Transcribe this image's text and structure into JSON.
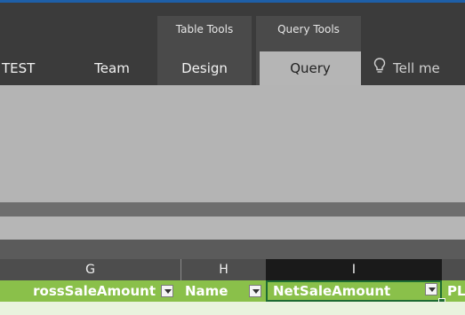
{
  "ribbon": {
    "contextual_groups": [
      {
        "label": "Table Tools"
      },
      {
        "label": "Query Tools"
      }
    ],
    "tabs": [
      "TEST",
      "Team",
      "Design",
      "Query"
    ],
    "active_tab": "Query",
    "tell_me": "Tell me"
  },
  "sheet": {
    "column_headers": [
      "G",
      "H",
      "I"
    ],
    "selected_column": "I",
    "field_headers": [
      "rossSaleAmount",
      "Name",
      "NetSaleAmount",
      "PL"
    ]
  },
  "colors": {
    "ribbon_dark": "#3b3b3b",
    "active_tab": "#b5b5b5",
    "table_header_green": "#8ac04a",
    "selection_border": "#1e6b32"
  }
}
